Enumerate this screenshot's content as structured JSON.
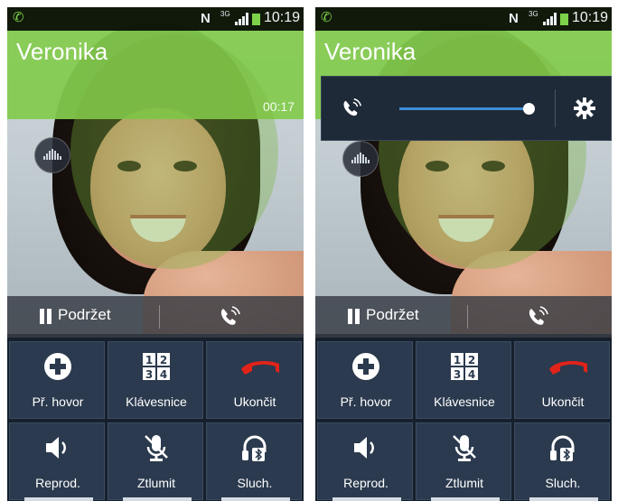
{
  "contact": {
    "name": "Veronika",
    "timer": "00:17"
  },
  "status_bar": {
    "network": "3G",
    "nfc_letter": "N",
    "time": "10:19"
  },
  "hold": {
    "label": "Podržet"
  },
  "buttons": {
    "add_call": "Př. hovor",
    "keypad": "Klávesnice",
    "end": "Ukončit",
    "speaker": "Reprod.",
    "mute": "Ztlumit",
    "headset": "Sluch."
  },
  "volume": {
    "level": 0.95
  },
  "colors": {
    "accent_green": "#83cb4e",
    "end_call_red": "#e2231a",
    "volume_blue": "#3b8fd8"
  }
}
